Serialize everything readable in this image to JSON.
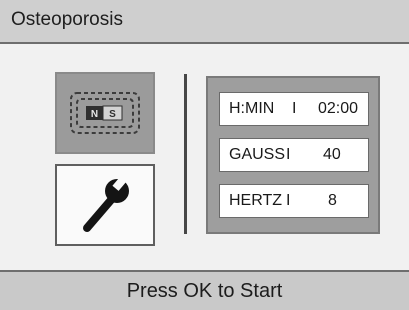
{
  "header": {
    "title": "Osteoporosis"
  },
  "buttons": {
    "magnet": {
      "north_label": "N",
      "south_label": "S"
    }
  },
  "fields": [
    {
      "label": "H:MIN",
      "separator": "I",
      "value": "02:00"
    },
    {
      "label": "GAUSS",
      "separator": "I",
      "value": "40"
    },
    {
      "label": "HERTZ",
      "separator": "I",
      "value": "8"
    }
  ],
  "footer": {
    "text": "Press OK to Start"
  },
  "icons": {
    "magnet_button": "magnet-icon",
    "settings_button": "wrench-icon"
  }
}
